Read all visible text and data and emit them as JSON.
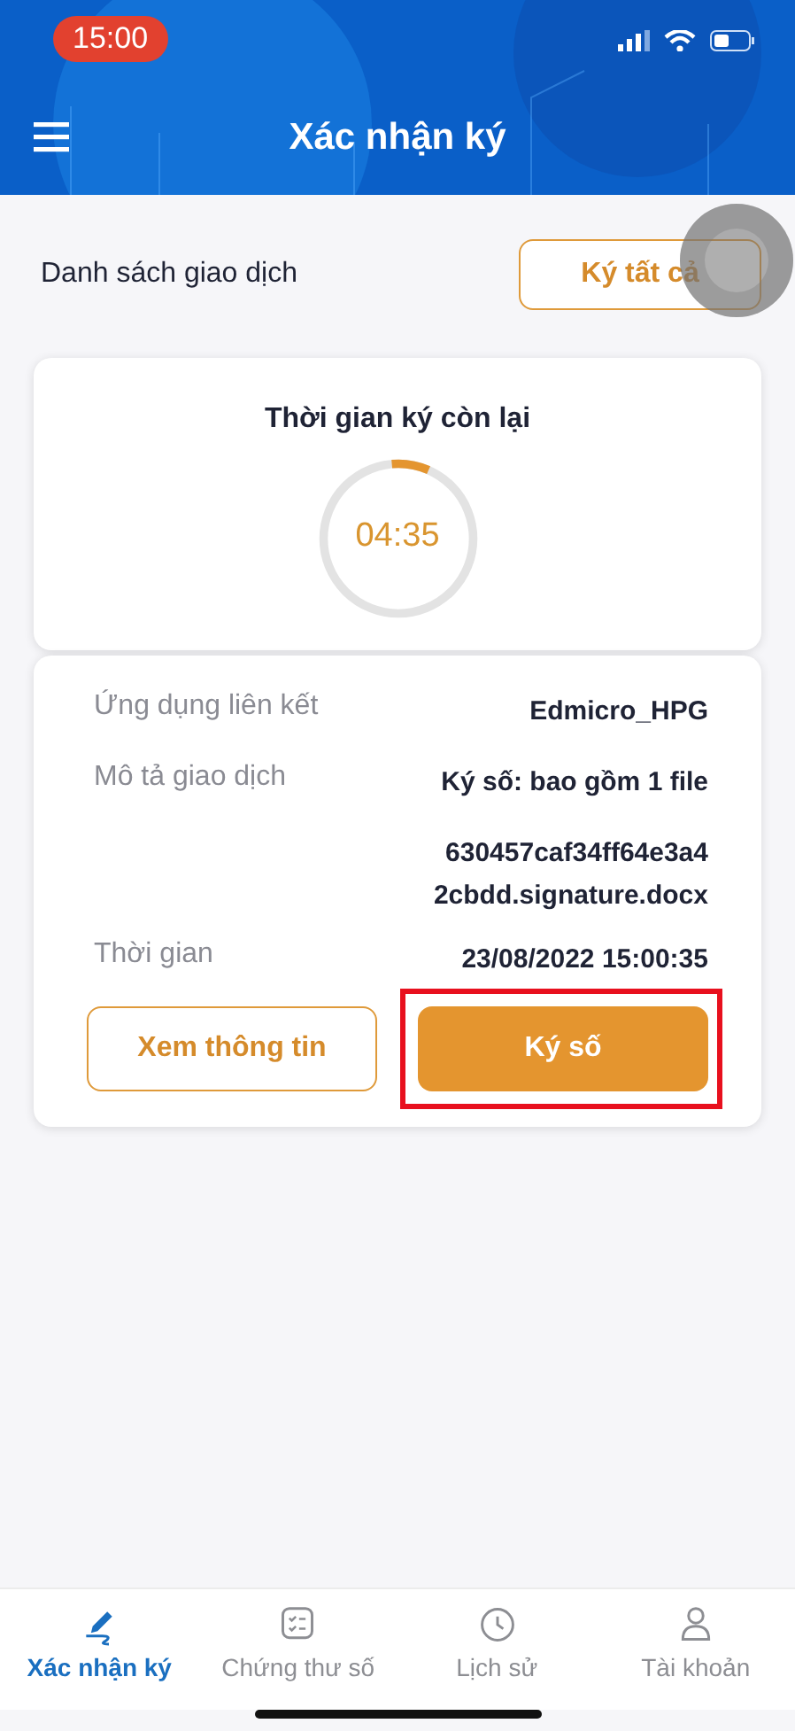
{
  "status_bar": {
    "time": "15:00"
  },
  "header": {
    "title": "Xác nhận ký"
  },
  "list_header": {
    "title": "Danh sách giao dịch",
    "button": "Ký tất cả",
    "touch_indicator": true
  },
  "timer": {
    "title": "Thời gian ký còn lại",
    "time": "04:35",
    "level": 0.08
  },
  "details": [
    {
      "label": "Ứng dụng liên kết",
      "value": "Edmicro_HPG"
    },
    {
      "label": "Mô tả giao dịch",
      "value": "Ký số: bao gồm 1 file"
    },
    {
      "value": "630457caf34ff64e3a4\n2cbdd.signature.docx"
    },
    {
      "label": "Thời gian",
      "value": "23/08/2022 15:00:35"
    }
  ],
  "actions": [
    {
      "label": "Xem thông tin",
      "kind": "outline",
      "highlighted": false
    },
    {
      "label": "Ký số",
      "kind": "filled",
      "highlighted": true
    }
  ],
  "tabs": [
    {
      "label": "Xác nhận ký",
      "selected": true
    },
    {
      "label": "Chứng thư số",
      "selected": false
    },
    {
      "label": "Lịch sử",
      "selected": false
    },
    {
      "label": "Tài khoản",
      "selected": false
    }
  ]
}
